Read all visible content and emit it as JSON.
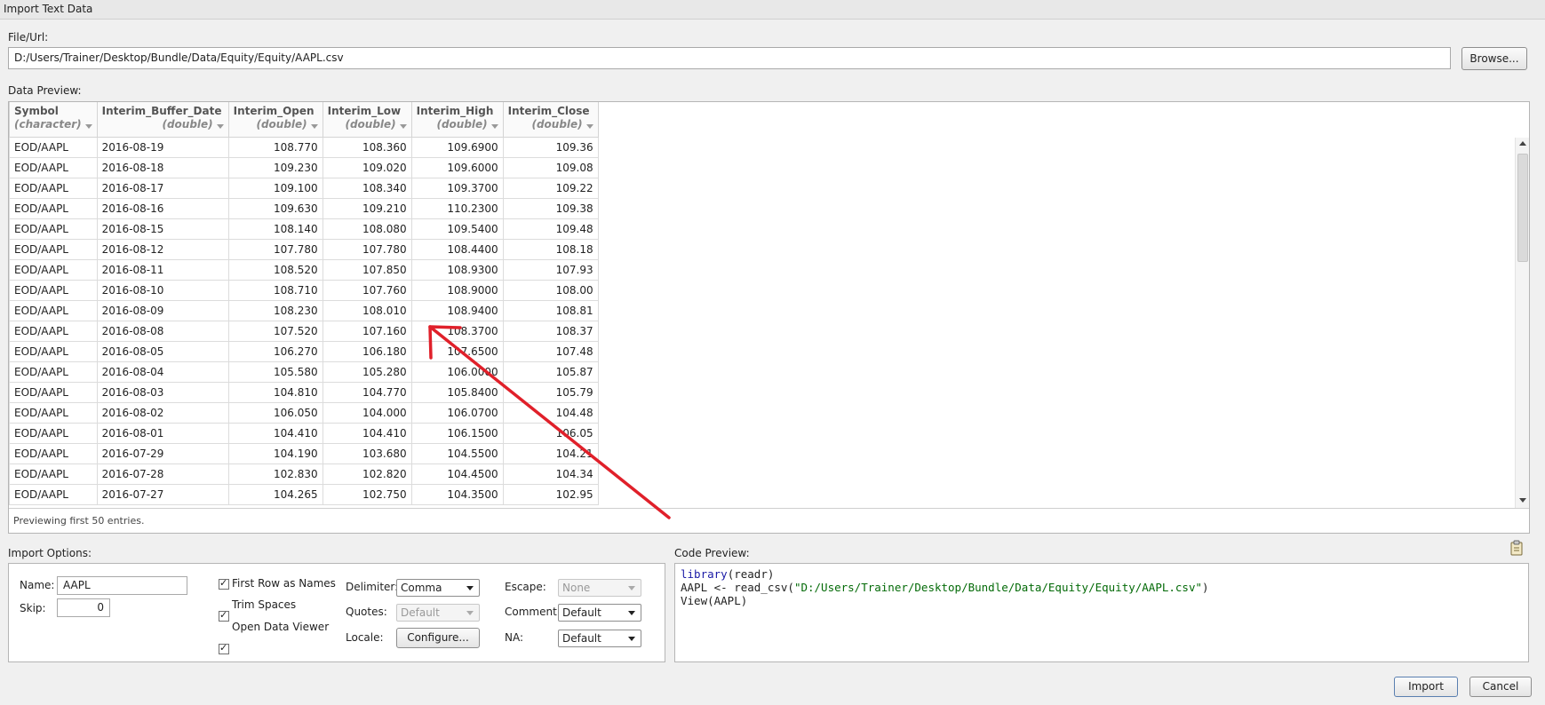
{
  "window": {
    "title": "Import Text Data"
  },
  "file": {
    "label": "File/Url:",
    "value": "D:/Users/Trainer/Desktop/Bundle/Data/Equity/Equity/AAPL.csv",
    "browse_label": "Browse..."
  },
  "preview": {
    "label": "Data Preview:",
    "columns": [
      {
        "name": "Symbol",
        "type": "(character)"
      },
      {
        "name": "Interim_Buffer_Date",
        "type": "(double)"
      },
      {
        "name": "Interim_Open",
        "type": "(double)"
      },
      {
        "name": "Interim_Low",
        "type": "(double)"
      },
      {
        "name": "Interim_High",
        "type": "(double)"
      },
      {
        "name": "Interim_Close",
        "type": "(double)"
      }
    ],
    "rows": [
      [
        "EOD/AAPL",
        "2016-08-19",
        "108.770",
        "108.360",
        "109.6900",
        "109.36"
      ],
      [
        "EOD/AAPL",
        "2016-08-18",
        "109.230",
        "109.020",
        "109.6000",
        "109.08"
      ],
      [
        "EOD/AAPL",
        "2016-08-17",
        "109.100",
        "108.340",
        "109.3700",
        "109.22"
      ],
      [
        "EOD/AAPL",
        "2016-08-16",
        "109.630",
        "109.210",
        "110.2300",
        "109.38"
      ],
      [
        "EOD/AAPL",
        "2016-08-15",
        "108.140",
        "108.080",
        "109.5400",
        "109.48"
      ],
      [
        "EOD/AAPL",
        "2016-08-12",
        "107.780",
        "107.780",
        "108.4400",
        "108.18"
      ],
      [
        "EOD/AAPL",
        "2016-08-11",
        "108.520",
        "107.850",
        "108.9300",
        "107.93"
      ],
      [
        "EOD/AAPL",
        "2016-08-10",
        "108.710",
        "107.760",
        "108.9000",
        "108.00"
      ],
      [
        "EOD/AAPL",
        "2016-08-09",
        "108.230",
        "108.010",
        "108.9400",
        "108.81"
      ],
      [
        "EOD/AAPL",
        "2016-08-08",
        "107.520",
        "107.160",
        "108.3700",
        "108.37"
      ],
      [
        "EOD/AAPL",
        "2016-08-05",
        "106.270",
        "106.180",
        "107.6500",
        "107.48"
      ],
      [
        "EOD/AAPL",
        "2016-08-04",
        "105.580",
        "105.280",
        "106.0000",
        "105.87"
      ],
      [
        "EOD/AAPL",
        "2016-08-03",
        "104.810",
        "104.770",
        "105.8400",
        "105.79"
      ],
      [
        "EOD/AAPL",
        "2016-08-02",
        "106.050",
        "104.000",
        "106.0700",
        "104.48"
      ],
      [
        "EOD/AAPL",
        "2016-08-01",
        "104.410",
        "104.410",
        "106.1500",
        "106.05"
      ],
      [
        "EOD/AAPL",
        "2016-07-29",
        "104.190",
        "103.680",
        "104.5500",
        "104.21"
      ],
      [
        "EOD/AAPL",
        "2016-07-28",
        "102.830",
        "102.820",
        "104.4500",
        "104.34"
      ],
      [
        "EOD/AAPL",
        "2016-07-27",
        "104.265",
        "102.750",
        "104.3500",
        "102.95"
      ]
    ],
    "footer": "Previewing first 50 entries."
  },
  "import_options": {
    "label": "Import Options:",
    "name_label": "Name:",
    "name_value": "AAPL",
    "skip_label": "Skip:",
    "skip_value": "0",
    "first_row_label": "First Row as Names",
    "trim_spaces_label": "Trim Spaces",
    "open_viewer_label": "Open Data Viewer",
    "delimiter_label": "Delimiter:",
    "delimiter_value": "Comma",
    "quotes_label": "Quotes:",
    "quotes_value": "Default",
    "locale_label": "Locale:",
    "configure_label": "Configure...",
    "escape_label": "Escape:",
    "escape_value": "None",
    "comment_label": "Comment:",
    "comment_value": "Default",
    "na_label": "NA:",
    "na_value": "Default"
  },
  "code_preview": {
    "label": "Code Preview:",
    "line1_kw": "library",
    "line1_rest": "(readr)",
    "line2_pre": "AAPL <- read_csv(",
    "line2_str": "\"D:/Users/Trainer/Desktop/Bundle/Data/Equity/Equity/AAPL.csv\"",
    "line2_post": ")",
    "line3": "View(AAPL)"
  },
  "buttons": {
    "import": "Import",
    "cancel": "Cancel"
  },
  "colors": {
    "annotation_arrow": "#e0202a"
  }
}
